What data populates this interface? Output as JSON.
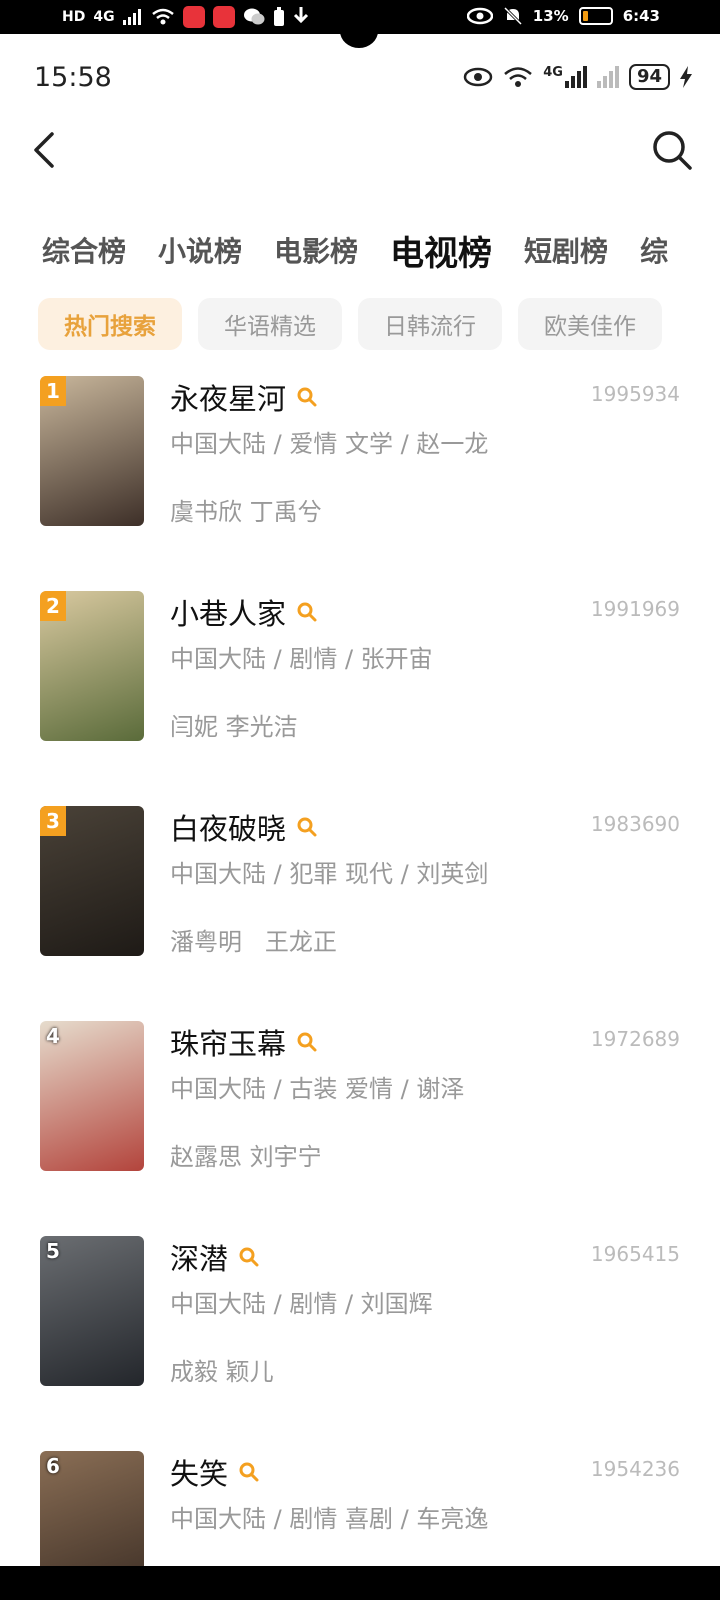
{
  "outer_status": {
    "left_icons": [
      "HD",
      "4G"
    ],
    "right_battery_percent": "13%",
    "time": "6:43"
  },
  "inner_status": {
    "time": "15:58",
    "network": "4G",
    "battery": "94"
  },
  "category_tabs": [
    {
      "label": "综合榜",
      "active": false
    },
    {
      "label": "小说榜",
      "active": false
    },
    {
      "label": "电影榜",
      "active": false
    },
    {
      "label": "电视榜",
      "active": true
    },
    {
      "label": "短剧榜",
      "active": false
    },
    {
      "label": "综",
      "active": false
    }
  ],
  "sub_tabs": [
    {
      "label": "热门搜索",
      "active": true
    },
    {
      "label": "华语精选",
      "active": false
    },
    {
      "label": "日韩流行",
      "active": false
    },
    {
      "label": "欧美佳作",
      "active": false
    }
  ],
  "items": [
    {
      "rank": "1",
      "title": "永夜星河",
      "score": "1995934",
      "meta": "中国大陆 / 爱情 文学 / 赵一龙",
      "cast": "虞书欣 丁禹兮",
      "poster_colors": [
        "#c9b79c",
        "#3d2f28"
      ]
    },
    {
      "rank": "2",
      "title": "小巷人家",
      "score": "1991969",
      "meta": "中国大陆 / 剧情 / 张开宙",
      "cast": "闫妮 李光洁",
      "poster_colors": [
        "#d9c9a0",
        "#5a6b3a"
      ]
    },
    {
      "rank": "3",
      "title": "白夜破晓",
      "score": "1983690",
      "meta": "中国大陆 / 犯罪 现代 / 刘英剑",
      "cast": "潘粤明   王龙正",
      "poster_colors": [
        "#4a4238",
        "#1e1a16"
      ]
    },
    {
      "rank": "4",
      "title": "珠帘玉幕",
      "score": "1972689",
      "meta": "中国大陆 / 古装 爱情 / 谢泽",
      "cast": "赵露思 刘宇宁",
      "poster_colors": [
        "#e6dccd",
        "#b3443c"
      ]
    },
    {
      "rank": "5",
      "title": "深潜",
      "score": "1965415",
      "meta": "中国大陆 / 剧情 / 刘国辉",
      "cast": "成毅 颖儿",
      "poster_colors": [
        "#6b6e72",
        "#23262b"
      ]
    },
    {
      "rank": "6",
      "title": "失笑",
      "score": "1954236",
      "meta": "中国大陆 / 剧情 喜剧 / 车亮逸",
      "cast": "",
      "poster_colors": [
        "#8a6e55",
        "#3b2d24"
      ]
    }
  ],
  "icons": {
    "back": "chevron-left-icon",
    "search": "search-icon",
    "hot_search": "search-small-icon"
  },
  "colors": {
    "accent": "#f4a020",
    "sub_tab_active_bg": "#fdf0e0",
    "sub_tab_active_text": "#e8a23c"
  }
}
